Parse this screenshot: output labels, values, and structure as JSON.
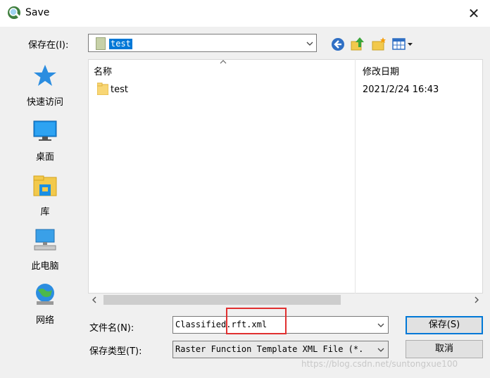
{
  "window": {
    "title": "Save",
    "close_glyph": "✕"
  },
  "toolbar": {
    "save_in_label": "保存在(I):",
    "save_in_value": "test",
    "buttons": [
      "back-icon",
      "up-folder-icon",
      "new-folder-icon",
      "view-menu-icon"
    ]
  },
  "places": [
    {
      "label": "快速访问",
      "icon": "star-icon"
    },
    {
      "label": "桌面",
      "icon": "desktop-icon"
    },
    {
      "label": "库",
      "icon": "library-icon"
    },
    {
      "label": "此电脑",
      "icon": "computer-icon"
    },
    {
      "label": "网络",
      "icon": "network-icon"
    }
  ],
  "file_list": {
    "columns": [
      "名称",
      "修改日期"
    ],
    "rows": [
      {
        "name": "test",
        "modified": "2021/2/24 16:43",
        "icon": "folder-icon"
      }
    ]
  },
  "form": {
    "filename_label": "文件名(N):",
    "filename_value": "Classified.rft.xml",
    "filetype_label": "保存类型(T):",
    "filetype_value": "Raster Function Template XML File (*.",
    "save_button": "保存(S)",
    "cancel_button": "取消"
  },
  "watermark": "https://blog.csdn.net/suntongxue100",
  "colors": {
    "accent": "#0078d7",
    "highlight_box": "#e03030"
  }
}
